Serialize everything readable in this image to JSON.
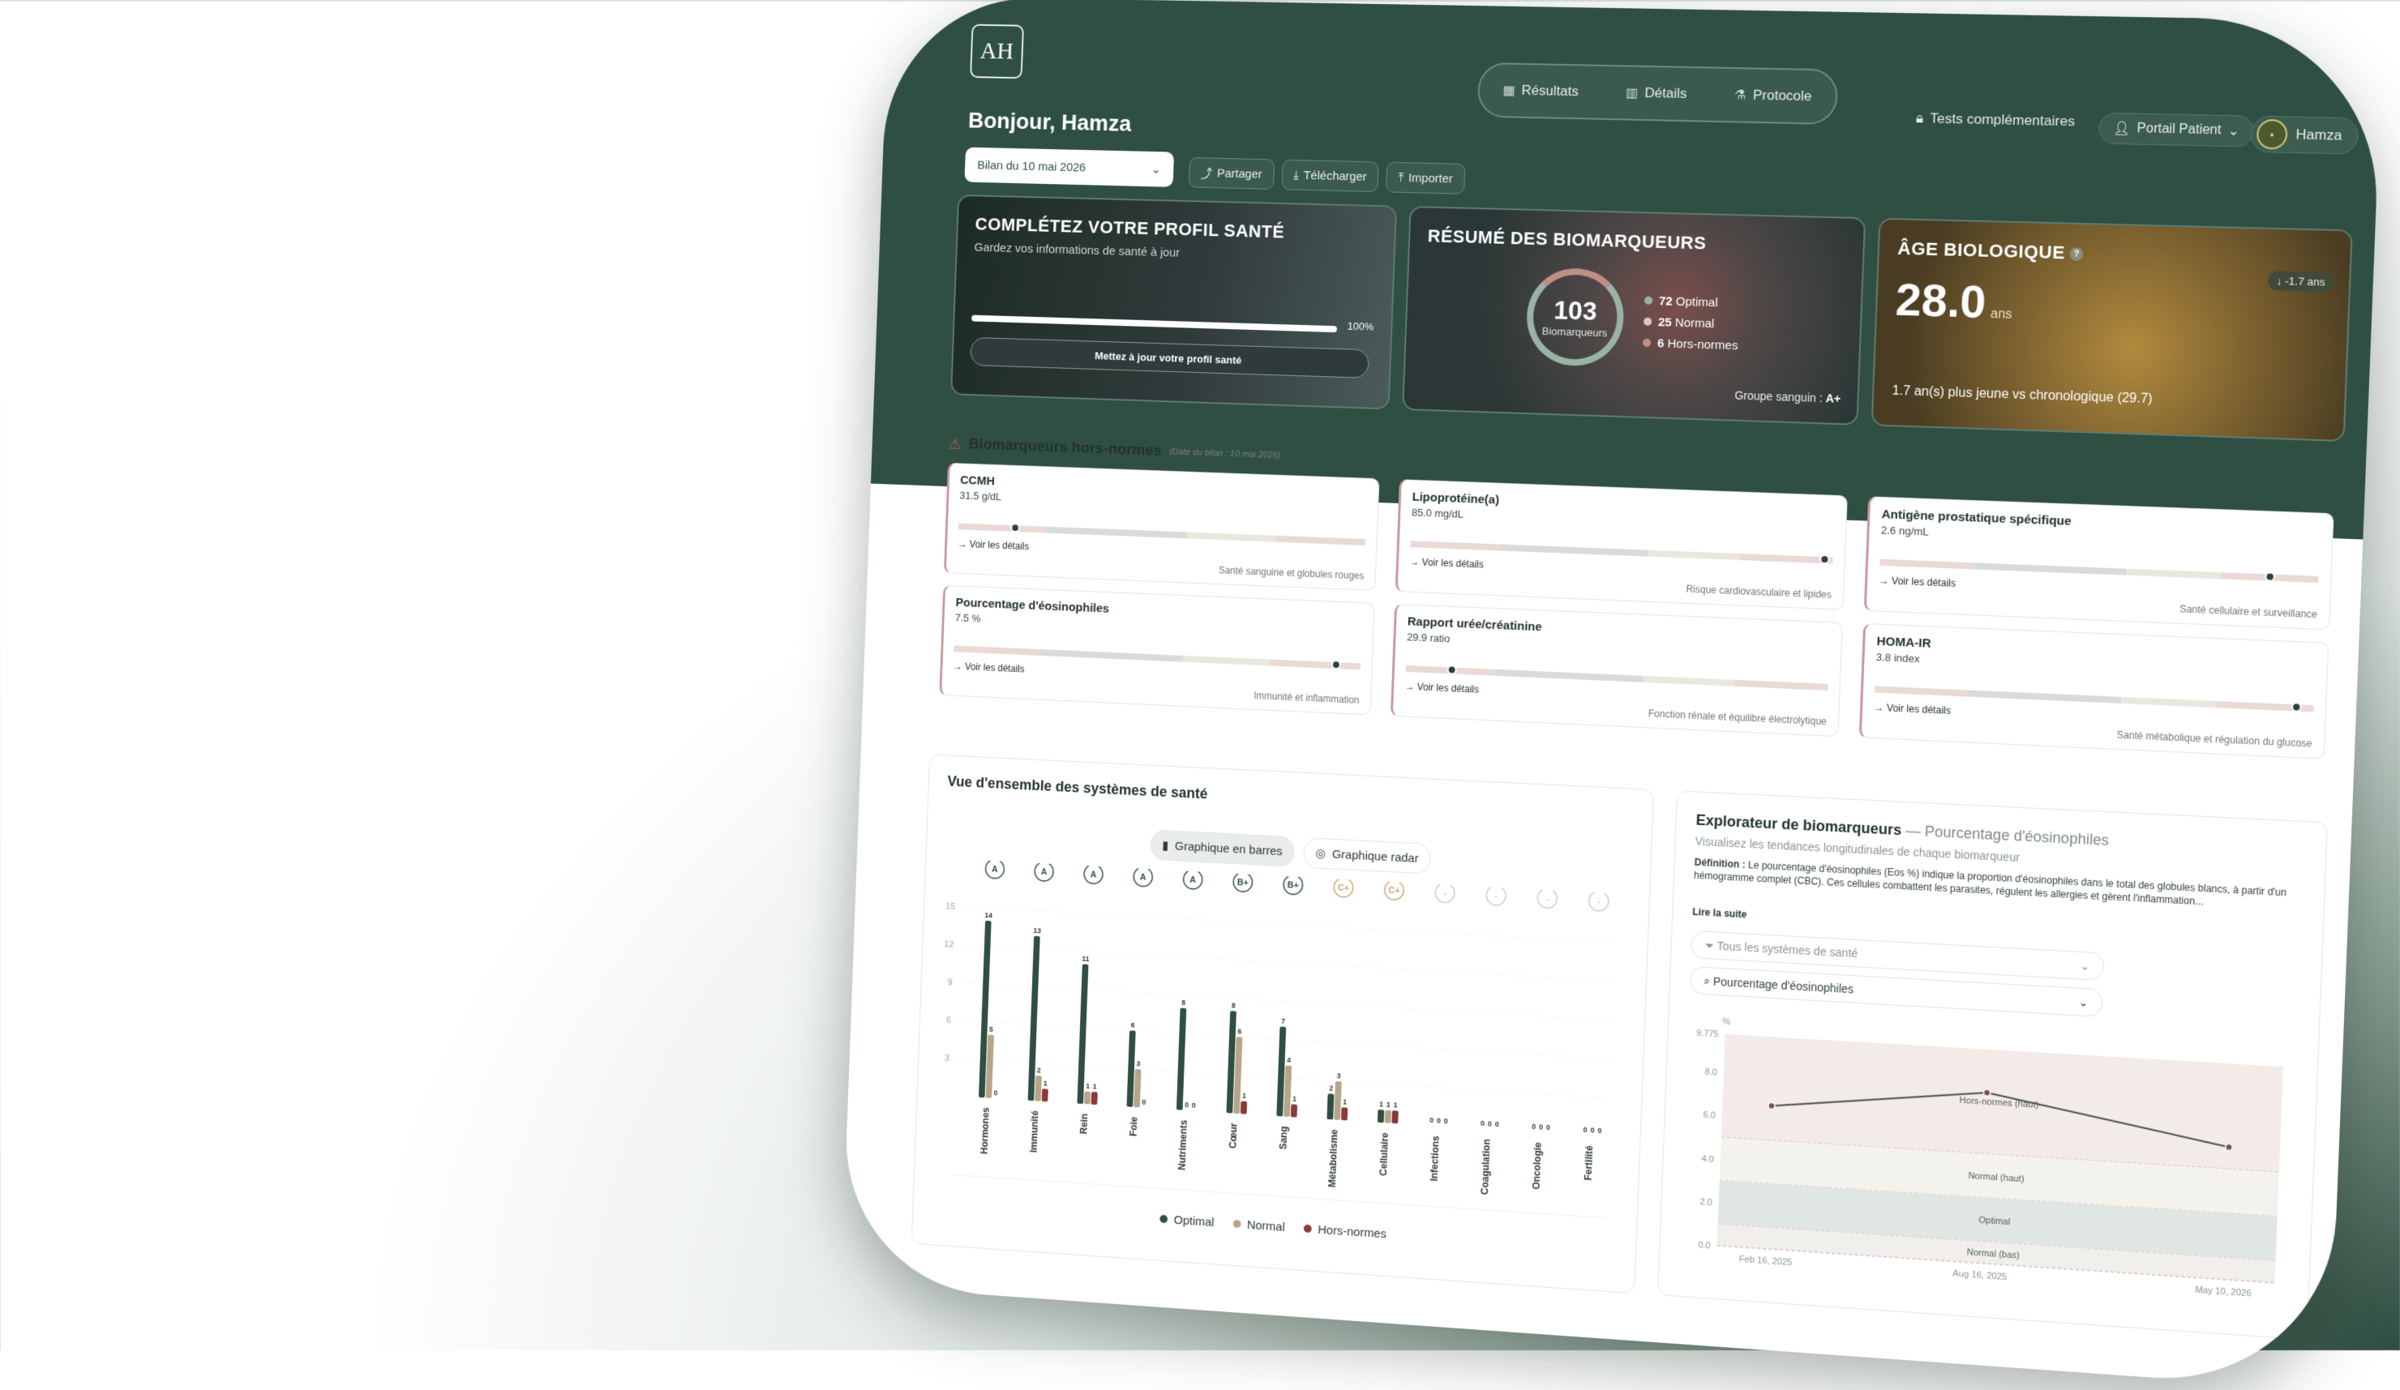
{
  "header": {
    "logo": "AH",
    "nav": [
      {
        "label": "Résultats",
        "icon": "grid-icon"
      },
      {
        "label": "Détails",
        "icon": "bar-chart-icon"
      },
      {
        "label": "Protocole",
        "icon": "flask-icon"
      }
    ],
    "tests_label": "Tests complémentaires",
    "portal_label": "Portail Patient",
    "user_name": "Hamza",
    "greeting": "Bonjour, Hamza",
    "report_select": "Bilan du 10 mai 2026",
    "actions": {
      "share": "Partager",
      "download": "Télécharger",
      "import": "Importer"
    }
  },
  "profile_card": {
    "title": "COMPLÉTEZ VOTRE PROFIL SANTÉ",
    "subtitle": "Gardez vos informations de santé à jour",
    "progress": 100,
    "progress_label": "100%",
    "cta": "Mettez à jour votre profil santé"
  },
  "summary_card": {
    "title": "RÉSUMÉ DES BIOMARQUEURS",
    "total": "103",
    "total_label": "Biomarqueurs",
    "optimal": "72",
    "optimal_label": "Optimal",
    "normal": "25",
    "normal_label": "Normal",
    "out": "6",
    "out_label": "Hors-normes",
    "blood_label": "Groupe sanguin :",
    "blood_value": "A+"
  },
  "age_card": {
    "title": "ÂGE BIOLOGIQUE",
    "value": "28.0",
    "unit": "ans",
    "badge": "↓ -1.7 ans",
    "note": "1.7 an(s) plus jeune vs chronologique (29.7)"
  },
  "outofrange": {
    "title": "Biomarqueurs hors-normes",
    "date": "(Date du bilan : 10 mai 2026)",
    "link": "→ Voir les détails",
    "items": [
      {
        "name": "CCMH",
        "value": "31.5",
        "unit": "g/dL",
        "category": "Santé sanguine et globules rouges",
        "marker": 0.13
      },
      {
        "name": "Lipoprotéine(a)",
        "value": "85.0",
        "unit": "mg/dL",
        "category": "Risque cardiovasculaire et lipides",
        "marker": 0.97
      },
      {
        "name": "Antigène prostatique spécifique",
        "value": "2.6",
        "unit": "ng/mL",
        "category": "Santé cellulaire et surveillance",
        "marker": 0.88
      },
      {
        "name": "Pourcentage d'éosinophiles",
        "value": "7.5",
        "unit": "%",
        "category": "Immunité et inflammation",
        "marker": 0.93
      },
      {
        "name": "Rapport urée/créatinine",
        "value": "29.9",
        "unit": "ratio",
        "category": "Fonction rénale et équilibre électrolytique",
        "marker": 0.1
      },
      {
        "name": "HOMA-IR",
        "value": "3.8",
        "unit": "index",
        "category": "Santé métabolique et régulation du glucose",
        "marker": 0.95
      }
    ]
  },
  "systems": {
    "title": "Vue d'ensemble des systèmes de santé",
    "toggle_bar": "Graphique en barres",
    "toggle_radar": "Graphique radar",
    "legend": {
      "optimal": "Optimal",
      "normal": "Normal",
      "out": "Hors-normes"
    },
    "colors": {
      "optimal": "#2f4f43",
      "normal": "#b7a58a",
      "out": "#8a3a3a"
    }
  },
  "chart_data": [
    {
      "type": "bar",
      "categories": [
        "Hormones",
        "Immunité",
        "Rein",
        "Foie",
        "Nutriments",
        "Cœur",
        "Sang",
        "Métabolisme",
        "Cellulaire",
        "Infections",
        "Coagulation",
        "Oncologie",
        "Fertilité"
      ],
      "grades": [
        "A",
        "A",
        "A",
        "A",
        "A",
        "B+",
        "B+",
        "C+",
        "C+",
        "-",
        "-",
        "-",
        "-"
      ],
      "series": [
        {
          "name": "Optimal",
          "values": [
            14,
            13,
            11,
            6,
            8,
            8,
            7,
            2,
            1,
            0,
            0,
            0,
            0
          ]
        },
        {
          "name": "Normal",
          "values": [
            5,
            2,
            1,
            3,
            0,
            6,
            4,
            3,
            1,
            0,
            0,
            0,
            0
          ]
        },
        {
          "name": "Hors-normes",
          "values": [
            0,
            1,
            1,
            0,
            0,
            1,
            1,
            1,
            1,
            0,
            0,
            0,
            0
          ]
        }
      ],
      "ylim": [
        0,
        15
      ],
      "yticks": [
        3,
        6,
        9,
        12,
        15
      ],
      "legend": "bottom"
    },
    {
      "type": "line",
      "x": [
        "Feb 16, 2025",
        "Aug 16, 2025",
        "May 10, 2026"
      ],
      "y": [
        6.6,
        7.8,
        6.0
      ],
      "ylabel": "%",
      "ylim": [
        0,
        9.775
      ],
      "yticks": [
        0.0,
        2.0,
        4.0,
        6.0,
        8.0,
        9.775
      ],
      "bands": [
        {
          "label": "Hors-normes (haut)",
          "from": 5.0,
          "to": 9.775
        },
        {
          "label": "Normal (haut)",
          "from": 3.0,
          "to": 5.0
        },
        {
          "label": "Optimal",
          "from": 1.0,
          "to": 3.0
        },
        {
          "label": "Normal (bas)",
          "from": 0.0,
          "to": 1.0
        }
      ]
    }
  ],
  "explorer": {
    "title": "Explorateur de biomarqueurs",
    "subtitle_sep": " — Pourcentage d'éosinophiles",
    "desc": "Visualisez les tendances longitudinales de chaque biomarqueur",
    "def_label": "Définition :",
    "def_text": " Le pourcentage d'éosinophiles (Eos %) indique la proportion d'éosinophiles dans le total des globules blancs, à partir d'un hémogramme complet (CBC). Ces cellules combattent les parasites, régulent les allergies et gèrent l'inflammation...",
    "more": "Lire la suite",
    "filter_placeholder": "Tous les systèmes de santé",
    "search_value": "Pourcentage d'éosinophiles"
  }
}
